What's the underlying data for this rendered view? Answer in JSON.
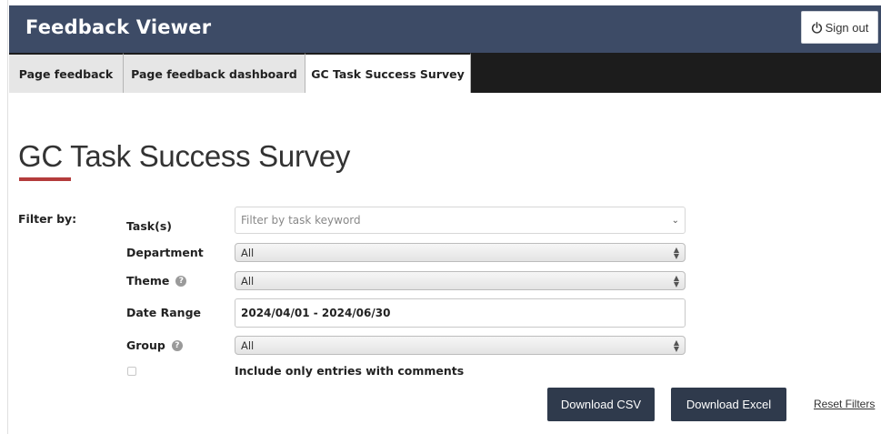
{
  "header": {
    "app_title": "Feedback Viewer",
    "signout_label": "Sign out"
  },
  "tabs": [
    {
      "label": "Page feedback",
      "active": false
    },
    {
      "label": "Page feedback dashboard",
      "active": false
    },
    {
      "label": "GC Task Success Survey",
      "active": true
    }
  ],
  "page": {
    "title": "GC Task Success Survey"
  },
  "filters": {
    "filter_by_label": "Filter by:",
    "task": {
      "label": "Task(s)",
      "placeholder": "Filter by task keyword"
    },
    "department": {
      "label": "Department",
      "value": "All"
    },
    "theme": {
      "label": "Theme",
      "value": "All"
    },
    "date_range": {
      "label": "Date Range",
      "value": "2024/04/01 - 2024/06/30"
    },
    "group": {
      "label": "Group",
      "value": "All"
    },
    "comments_only": {
      "label": "Include only entries with comments",
      "checked": false
    }
  },
  "actions": {
    "download_csv": "Download CSV",
    "download_excel": "Download Excel",
    "reset_filters": "Reset Filters"
  },
  "colors": {
    "header_bg": "#3d4b66",
    "tabbar_bg": "#1c1c1c",
    "title_accent": "#b43c3c",
    "button_bg": "#2f3a4c"
  },
  "icons": {
    "signout": "power-icon",
    "help": "help-circle-icon",
    "dropdown": "chevron-down-icon",
    "select": "updown-arrows-icon"
  }
}
